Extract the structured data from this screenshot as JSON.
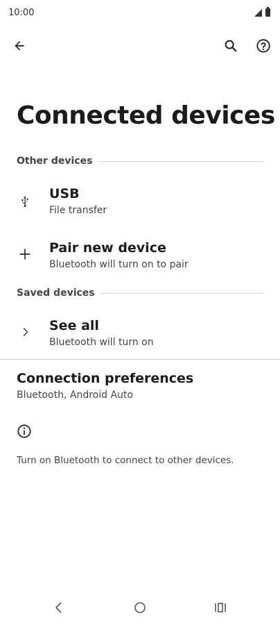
{
  "status_bar": {
    "time": "10:00"
  },
  "app_bar": {
    "back_icon": "arrow-back-icon",
    "search_icon": "search-icon",
    "help_icon": "help-icon"
  },
  "page": {
    "title": "Connected devices"
  },
  "sections": {
    "other": {
      "header": "Other devices",
      "items": [
        {
          "icon": "usb-icon",
          "title": "USB",
          "subtitle": "File transfer"
        },
        {
          "icon": "plus-icon",
          "title": "Pair new device",
          "subtitle": "Bluetooth will turn on to pair"
        }
      ]
    },
    "saved": {
      "header": "Saved devices",
      "items": [
        {
          "icon": "chevron-right-icon",
          "title": "See all",
          "subtitle": "Bluetooth will turn on"
        }
      ]
    }
  },
  "preferences": {
    "title": "Connection preferences",
    "subtitle": "Bluetooth, Android Auto"
  },
  "info": {
    "icon": "info-icon",
    "text": "Turn on Bluetooth to connect to other devices."
  },
  "nav_bar": {
    "back_icon": "nav-back-icon",
    "home_icon": "nav-home-icon",
    "recents_icon": "nav-recents-icon"
  }
}
